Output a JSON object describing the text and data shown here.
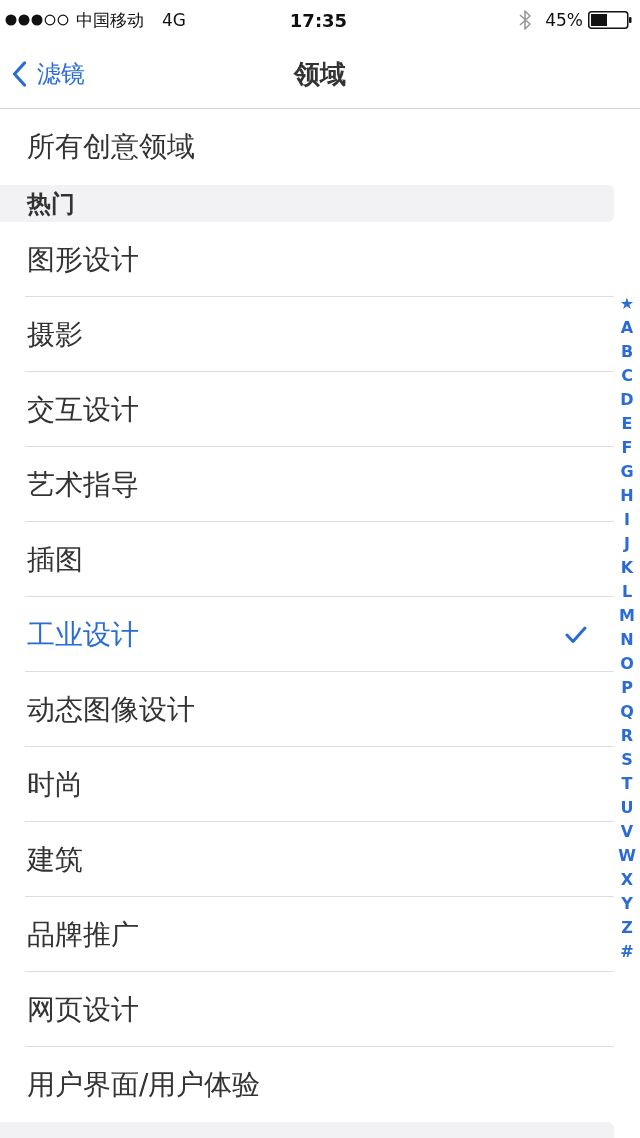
{
  "status_bar": {
    "carrier": "中国移动",
    "network": "4G",
    "time": "17:35",
    "battery": "45%"
  },
  "nav_bar": {
    "back": "滤镜",
    "title": "领域"
  },
  "all_item": {
    "label": "所有创意领域",
    "selected": false
  },
  "sections": [
    {
      "header": "热门",
      "items": [
        {
          "label": "图形设计",
          "selected": false
        },
        {
          "label": "摄影",
          "selected": false
        },
        {
          "label": "交互设计",
          "selected": false
        },
        {
          "label": "艺术指导",
          "selected": false
        },
        {
          "label": "插图",
          "selected": false
        },
        {
          "label": "工业设计",
          "selected": true
        },
        {
          "label": "动态图像设计",
          "selected": false
        },
        {
          "label": "时尚",
          "selected": false
        },
        {
          "label": "建筑",
          "selected": false
        },
        {
          "label": "品牌推广",
          "selected": false
        },
        {
          "label": "网页设计",
          "selected": false
        },
        {
          "label": "用户界面/用户体验",
          "selected": false
        }
      ]
    }
  ],
  "section_index": [
    "★",
    "A",
    "B",
    "C",
    "D",
    "E",
    "F",
    "G",
    "H",
    "I",
    "J",
    "K",
    "L",
    "M",
    "N",
    "O",
    "P",
    "Q",
    "R",
    "S",
    "T",
    "U",
    "V",
    "W",
    "X",
    "Y",
    "Z",
    "#"
  ]
}
